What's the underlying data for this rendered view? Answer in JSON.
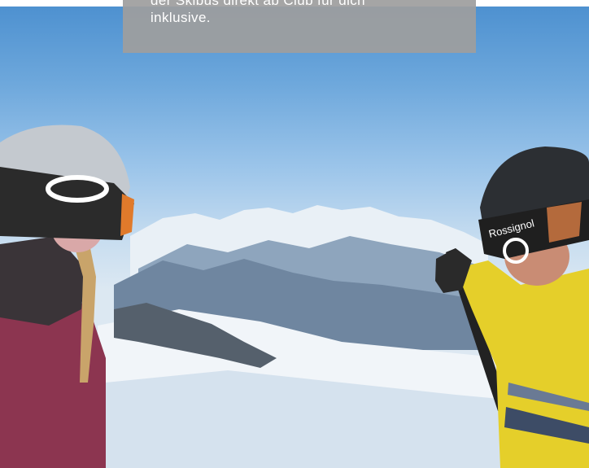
{
  "caption": {
    "lines": [
      "der Skibus direkt ab Club für dich",
      "inklusive."
    ]
  },
  "photo": {
    "subject": "two skiers looking at snowy mountain panorama",
    "left_skier_helmet_brand": "OAKLEY-style logo",
    "right_skier_helmet_text": "Rossignol"
  },
  "colors": {
    "sky_top": "#4b8fcf",
    "caption_bg": "#9e9e9e",
    "jacket_yellow": "#e5cf2a",
    "jacket_pink": "#8c3550"
  }
}
